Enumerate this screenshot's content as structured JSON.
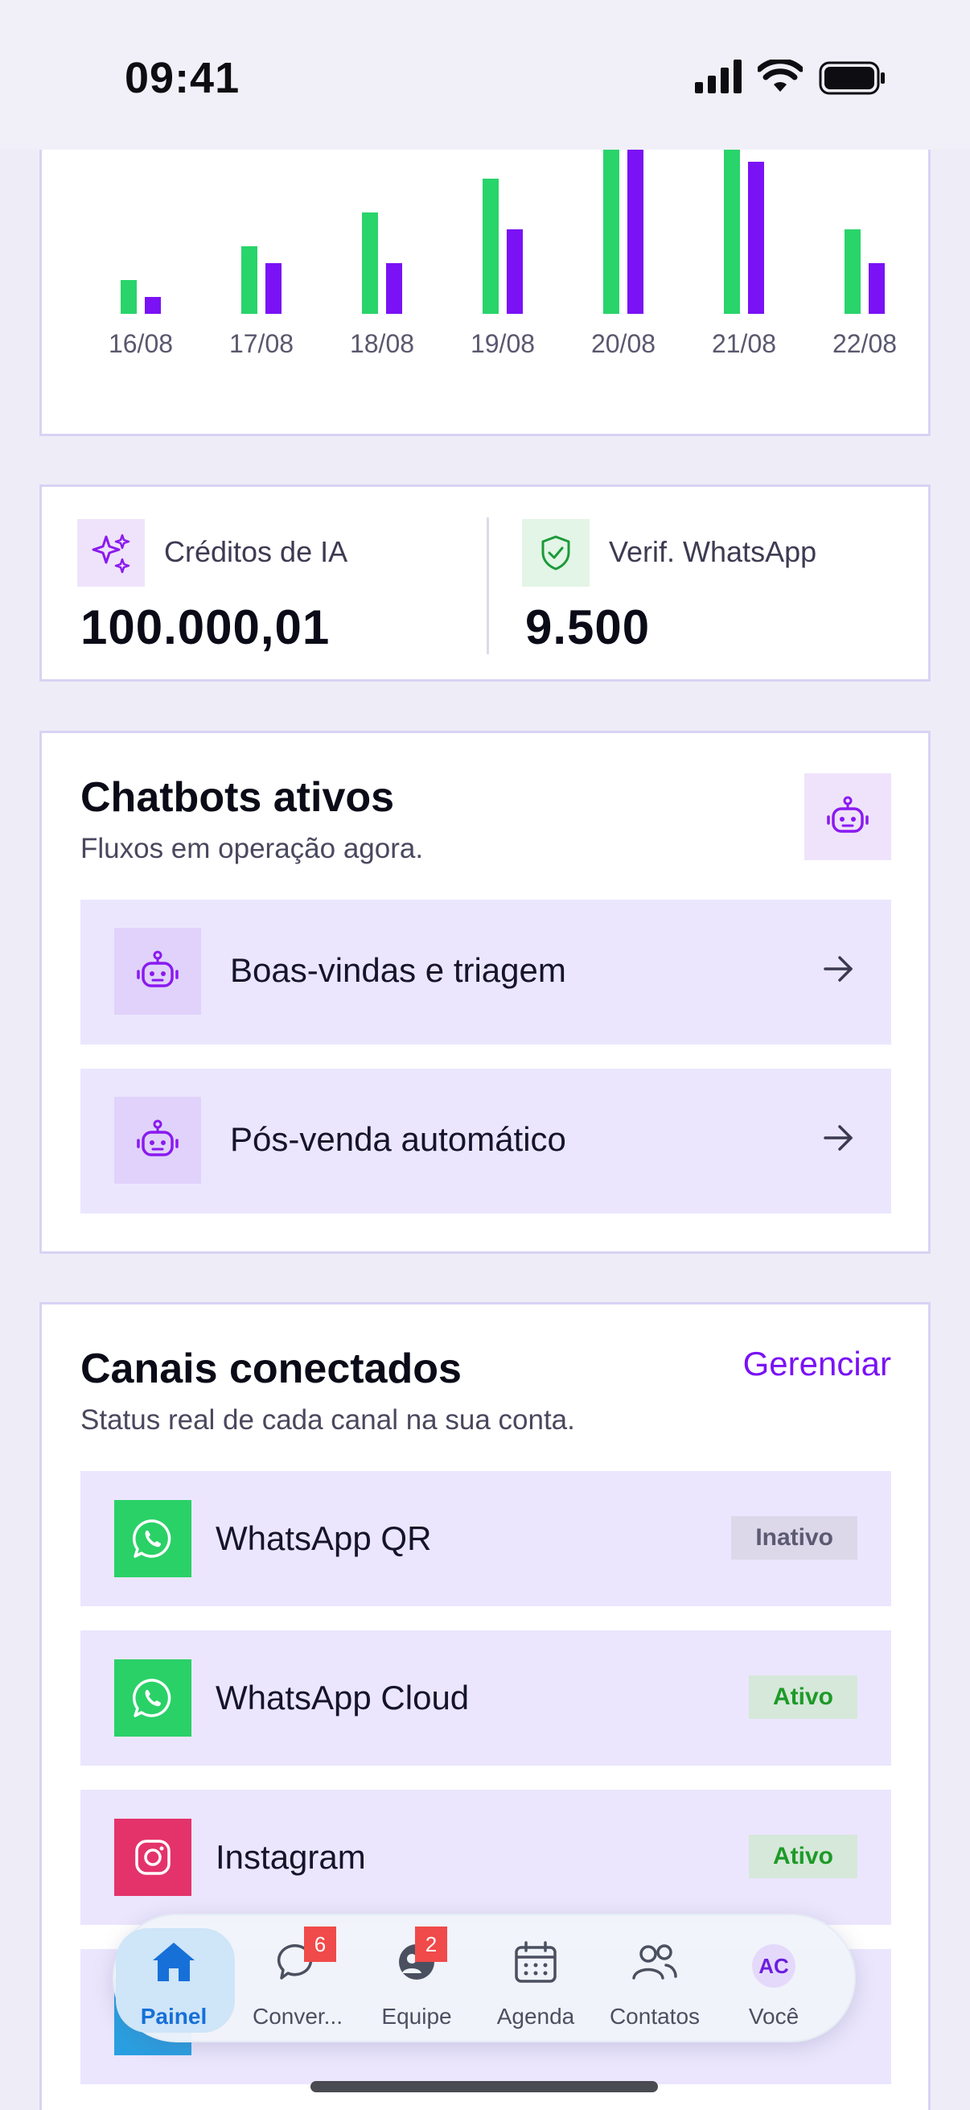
{
  "status_bar": {
    "time": "09:41"
  },
  "chart_data": {
    "type": "bar",
    "categories": [
      "16/08",
      "17/08",
      "18/08",
      "19/08",
      "20/08",
      "21/08",
      "22/08"
    ],
    "series": [
      {
        "color": "#29d46a",
        "values": [
          4,
          8,
          12,
          16,
          26,
          25,
          10
        ]
      },
      {
        "color": "#7a12f5",
        "values": [
          2,
          6,
          6,
          10,
          27,
          18,
          6
        ]
      }
    ],
    "ylim": [
      0,
      20
    ]
  },
  "credits": {
    "ai": {
      "label": "Créditos de IA",
      "value": "100.000,01",
      "icon": "sparkles-icon"
    },
    "whatsapp": {
      "label": "Verif. WhatsApp",
      "value": "9.500",
      "icon": "shield-check-icon"
    }
  },
  "chatbots": {
    "title": "Chatbots ativos",
    "subtitle": "Fluxos em operação agora.",
    "items": [
      {
        "label": "Boas-vindas e triagem"
      },
      {
        "label": "Pós-venda automático"
      }
    ]
  },
  "channels": {
    "title": "Canais conectados",
    "subtitle": "Status real de cada canal na sua conta.",
    "manage_label": "Gerenciar",
    "items": [
      {
        "label": "WhatsApp QR",
        "status": "Inativo",
        "icon": "whatsapp-icon"
      },
      {
        "label": "WhatsApp Cloud",
        "status": "Ativo",
        "icon": "whatsapp-icon"
      },
      {
        "label": "Instagram",
        "status": "Ativo",
        "icon": "instagram-icon"
      }
    ]
  },
  "tabbar": {
    "items": [
      {
        "label": "Painel",
        "icon": "home-icon"
      },
      {
        "label": "Conver...",
        "icon": "chat-icon",
        "count": "6"
      },
      {
        "label": "Equipe",
        "icon": "team-chat-icon",
        "count": "2"
      },
      {
        "label": "Agenda",
        "icon": "calendar-icon"
      },
      {
        "label": "Contatos",
        "icon": "contacts-icon"
      },
      {
        "label": "Você",
        "avatar": "AC"
      }
    ]
  },
  "colors": {
    "accent": "#7a12f5",
    "green": "#29d46a",
    "active_tab": "#1670d8",
    "background": "#eeedf7"
  }
}
